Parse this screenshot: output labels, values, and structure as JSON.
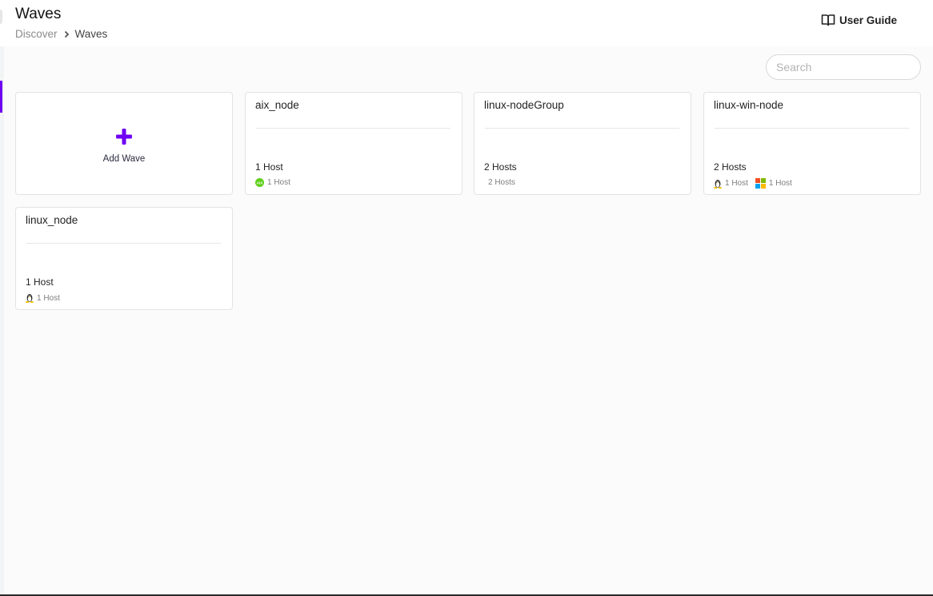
{
  "header": {
    "title": "Waves",
    "breadcrumb": [
      {
        "label": "Discover"
      },
      {
        "label": "Waves"
      }
    ],
    "user_guide_label": "User Guide"
  },
  "search": {
    "placeholder": "Search",
    "value": ""
  },
  "colors": {
    "accent": "#6f00f2",
    "aix_green": "#5fcf1a",
    "linux_yellow": "#f0c000"
  },
  "add_wave": {
    "label": "Add Wave",
    "icon": "plus-icon"
  },
  "waves": [
    {
      "name": "aix_node",
      "hosts_label": "1 Host",
      "breakdown": [
        {
          "os": "aix",
          "icon": "aix-icon",
          "label": "1 Host"
        }
      ]
    },
    {
      "name": "linux-nodeGroup",
      "hosts_label": "2 Hosts",
      "breakdown": [
        {
          "os": "unknown",
          "icon": "",
          "label": "2 Hosts"
        }
      ]
    },
    {
      "name": "linux-win-node",
      "hosts_label": "2 Hosts",
      "breakdown": [
        {
          "os": "linux",
          "icon": "linux-icon",
          "label": "1 Host"
        },
        {
          "os": "windows",
          "icon": "windows-icon",
          "label": "1 Host"
        }
      ]
    },
    {
      "name": "linux_node",
      "hosts_label": "1 Host",
      "breakdown": [
        {
          "os": "linux",
          "icon": "linux-icon",
          "label": "1 Host"
        }
      ]
    }
  ]
}
